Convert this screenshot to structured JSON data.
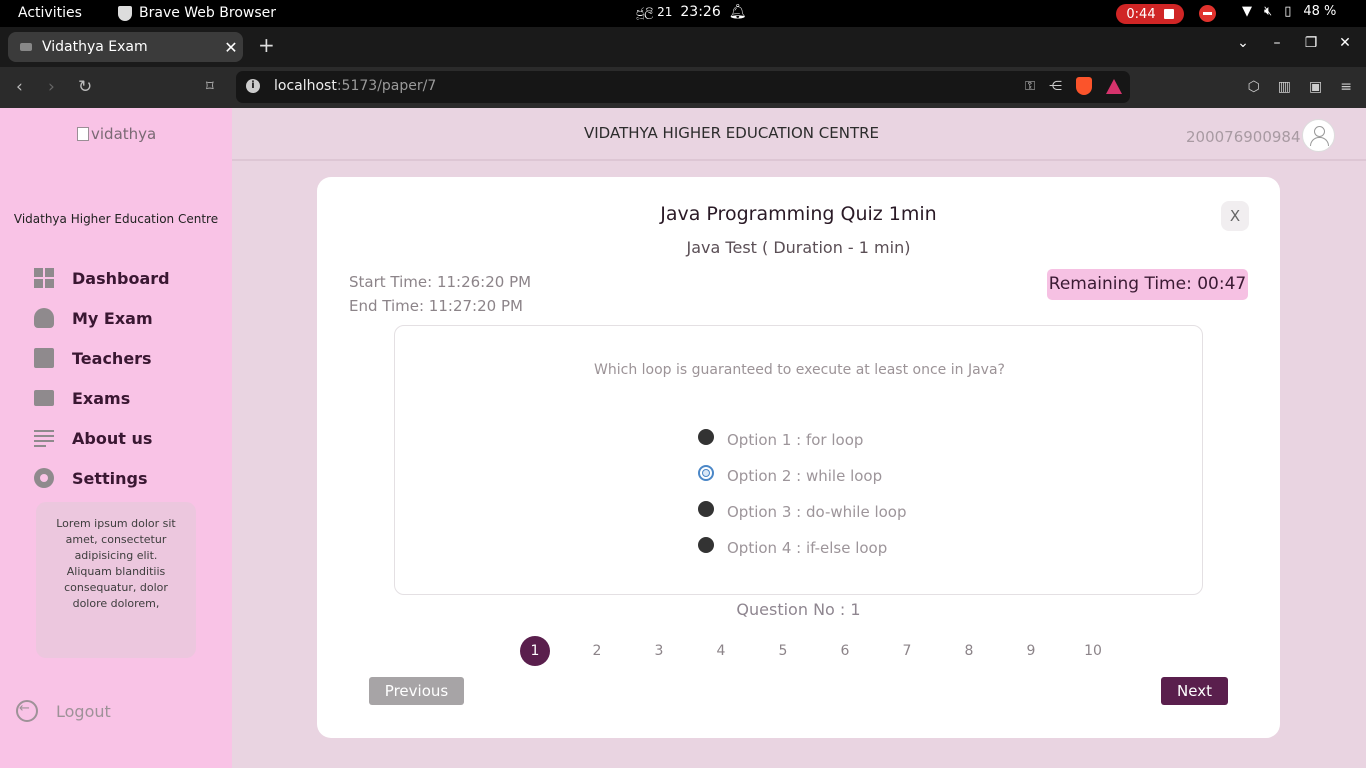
{
  "os_bar": {
    "activities": "Activities",
    "app_name": "Brave Web Browser",
    "date": "ජූලි 21",
    "time": "23:26",
    "recording_time": "0:44",
    "battery": "48 %"
  },
  "browser": {
    "tab_title": "Vidathya Exam",
    "url_host": "localhost",
    "url_path": ":5173/paper/7"
  },
  "sidebar": {
    "logo_alt": "vidathya",
    "org_name": "Vidathya Higher Education Centre",
    "items": [
      {
        "label": "Dashboard",
        "icon": "dashboard-icon"
      },
      {
        "label": "My Exam",
        "icon": "graduate-icon"
      },
      {
        "label": "Teachers",
        "icon": "teacher-icon"
      },
      {
        "label": "Exams",
        "icon": "image-icon"
      },
      {
        "label": "About us",
        "icon": "lines-icon"
      },
      {
        "label": "Settings",
        "icon": "gear-icon"
      }
    ],
    "card_text": "Lorem ipsum dolor sit amet, consectetur adipisicing elit. Aliquam blanditiis consequatur, dolor dolore dolorem,",
    "logout": "Logout"
  },
  "header": {
    "title": "VIDATHYA HIGHER EDUCATION CENTRE",
    "user_id": "200076900984"
  },
  "quiz": {
    "title": "Java Programming Quiz 1min",
    "subtitle": "Java Test ( Duration - 1 min)",
    "close_label": "X",
    "start_time": "Start Time: 11:26:20 PM",
    "end_time": "End Time: 11:27:20 PM",
    "remaining": "Remaining Time: 00:47",
    "question": "Which loop is guaranteed to execute at least once in Java?",
    "options": [
      "Option 1 : for loop",
      "Option 2 : while loop",
      "Option 3 : do-while loop",
      "Option 4 : if-else loop"
    ],
    "selected_option": 2,
    "question_no": "Question No : 1",
    "pages": [
      "1",
      "2",
      "3",
      "4",
      "5",
      "6",
      "7",
      "8",
      "9",
      "10"
    ],
    "active_page": "1",
    "prev_label": "Previous",
    "next_label": "Next"
  }
}
